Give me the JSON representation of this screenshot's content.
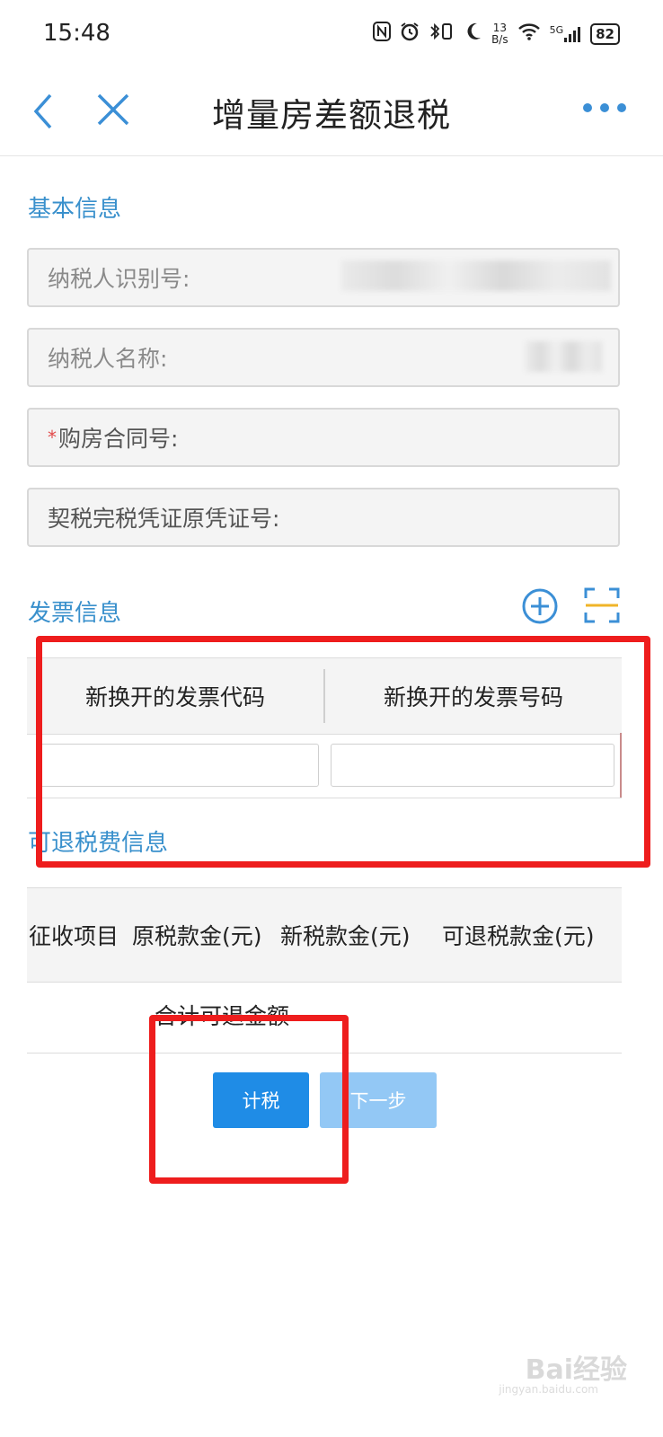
{
  "status_bar": {
    "time": "15:48",
    "net_speed_value": "13",
    "net_speed_unit": "B/s",
    "signal_label": "5G",
    "battery": "82"
  },
  "nav": {
    "title": "增量房差额退税"
  },
  "basic_info": {
    "title": "基本信息",
    "fields": [
      {
        "label": "纳税人识别号:",
        "value": ""
      },
      {
        "label": "纳税人名称:",
        "value": ""
      },
      {
        "label": "购房合同号:",
        "required_mark": "*",
        "value": ""
      },
      {
        "label": "契税完税凭证原凭证号:",
        "value": ""
      }
    ]
  },
  "invoice_info": {
    "title": "发票信息",
    "columns": [
      "新换开的发票代码",
      "新换开的发票号码"
    ],
    "row": {
      "code": "",
      "number": ""
    }
  },
  "refund_info": {
    "title": "可退税费信息",
    "columns": [
      "征收项目",
      "原税款金(元)",
      "新税款金(元)",
      "可退税款金(元)"
    ],
    "total_label": "合计可退金额"
  },
  "actions": {
    "calculate": "计税",
    "next": "下一步"
  },
  "watermark": {
    "brand": "Bai经验",
    "url": "jingyan.baidu.com"
  },
  "colors": {
    "accent": "#3990cc",
    "primary_button": "#1f8ce6",
    "disabled_button": "#93c8f5",
    "highlight_box": "#ee1d1d"
  }
}
